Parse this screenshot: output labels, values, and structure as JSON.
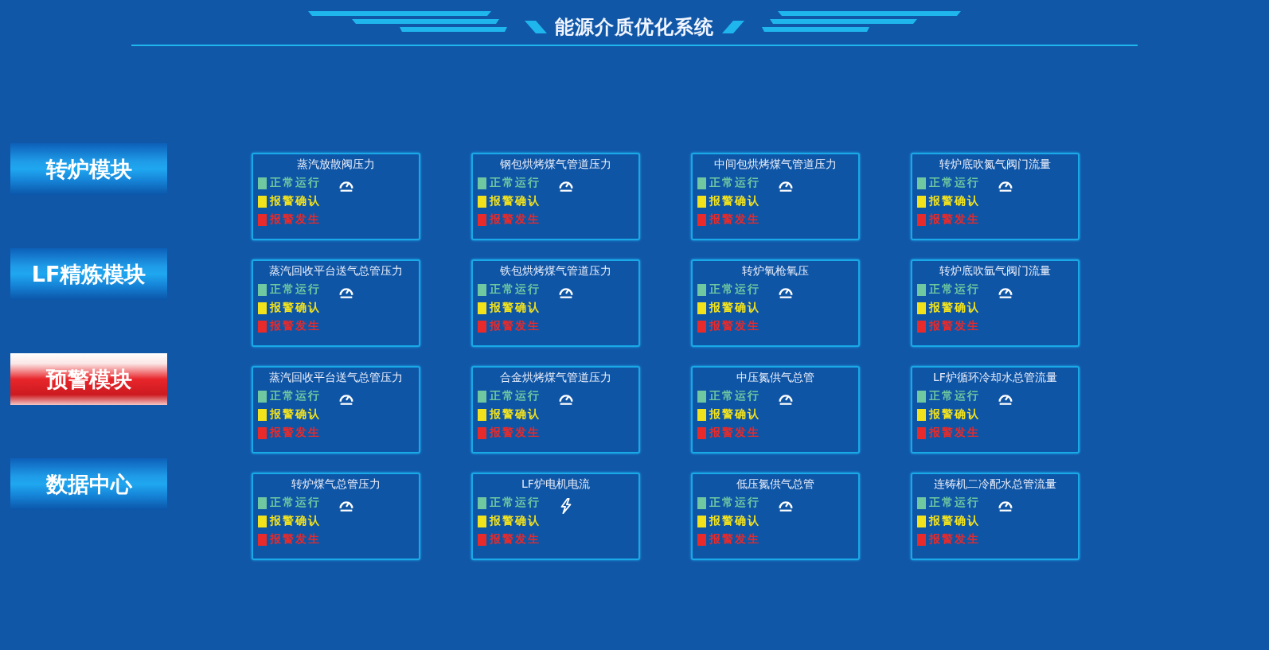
{
  "header": {
    "title": "能源介质优化系统"
  },
  "sidebar": {
    "items": [
      {
        "label": "转炉模块",
        "selected": false
      },
      {
        "label": "LF精炼模块",
        "selected": false
      },
      {
        "label": "预警模块",
        "selected": true
      },
      {
        "label": "数据中心",
        "selected": false
      }
    ]
  },
  "cards": [
    {
      "title": "蒸汽放散阀压力",
      "kind": "gauge",
      "legend": [
        {
          "label": "正常运行",
          "color": "#6fc8a0"
        },
        {
          "label": "报警确认",
          "color": "#f2e21c"
        },
        {
          "label": "报警发生",
          "color": "#e82a2a"
        }
      ]
    },
    {
      "title": "钢包烘烤煤气管道压力",
      "kind": "gauge",
      "legend": [
        {
          "label": "正常运行",
          "color": "#6fc8a0"
        },
        {
          "label": "报警确认",
          "color": "#f2e21c"
        },
        {
          "label": "报警发生",
          "color": "#e82a2a"
        }
      ]
    },
    {
      "title": "中间包烘烤煤气管道压力",
      "kind": "gauge",
      "legend": [
        {
          "label": "正常运行",
          "color": "#6fc8a0"
        },
        {
          "label": "报警确认",
          "color": "#f2e21c"
        },
        {
          "label": "报警发生",
          "color": "#e82a2a"
        }
      ]
    },
    {
      "title": "转炉底吹氮气阀门流量",
      "kind": "gauge",
      "legend": [
        {
          "label": "正常运行",
          "color": "#6fc8a0"
        },
        {
          "label": "报警确认",
          "color": "#f2e21c"
        },
        {
          "label": "报警发生",
          "color": "#e82a2a"
        }
      ]
    },
    {
      "title": "蒸汽回收平台送气总管压力",
      "kind": "gauge",
      "legend": [
        {
          "label": "正常运行",
          "color": "#6fc8a0"
        },
        {
          "label": "报警确认",
          "color": "#f2e21c"
        },
        {
          "label": "报警发生",
          "color": "#e82a2a"
        }
      ]
    },
    {
      "title": "铁包烘烤煤气管道压力",
      "kind": "gauge",
      "legend": [
        {
          "label": "正常运行",
          "color": "#6fc8a0"
        },
        {
          "label": "报警确认",
          "color": "#f2e21c"
        },
        {
          "label": "报警发生",
          "color": "#e82a2a"
        }
      ]
    },
    {
      "title": "转炉氧枪氧压",
      "kind": "gauge",
      "legend": [
        {
          "label": "正常运行",
          "color": "#6fc8a0"
        },
        {
          "label": "报警确认",
          "color": "#f2e21c"
        },
        {
          "label": "报警发生",
          "color": "#e82a2a"
        }
      ]
    },
    {
      "title": "转炉底吹氩气阀门流量",
      "kind": "gauge",
      "legend": [
        {
          "label": "正常运行",
          "color": "#6fc8a0"
        },
        {
          "label": "报警确认",
          "color": "#f2e21c"
        },
        {
          "label": "报警发生",
          "color": "#e82a2a"
        }
      ]
    },
    {
      "title": "蒸汽回收平台送气总管压力",
      "kind": "gauge",
      "legend": [
        {
          "label": "正常运行",
          "color": "#6fc8a0"
        },
        {
          "label": "报警确认",
          "color": "#f2e21c"
        },
        {
          "label": "报警发生",
          "color": "#e82a2a"
        }
      ]
    },
    {
      "title": "合金烘烤煤气管道压力",
      "kind": "gauge",
      "legend": [
        {
          "label": "正常运行",
          "color": "#6fc8a0"
        },
        {
          "label": "报警确认",
          "color": "#f2e21c"
        },
        {
          "label": "报警发生",
          "color": "#e82a2a"
        }
      ]
    },
    {
      "title": "中压氮供气总管",
      "kind": "gauge",
      "legend": [
        {
          "label": "正常运行",
          "color": "#6fc8a0"
        },
        {
          "label": "报警确认",
          "color": "#f2e21c"
        },
        {
          "label": "报警发生",
          "color": "#e82a2a"
        }
      ]
    },
    {
      "title": "LF炉循环冷却水总管流量",
      "kind": "gauge",
      "legend": [
        {
          "label": "正常运行",
          "color": "#6fc8a0"
        },
        {
          "label": "报警确认",
          "color": "#f2e21c"
        },
        {
          "label": "报警发生",
          "color": "#e82a2a"
        }
      ]
    },
    {
      "title": "转炉煤气总管压力",
      "kind": "gauge",
      "legend": [
        {
          "label": "正常运行",
          "color": "#6fc8a0"
        },
        {
          "label": "报警确认",
          "color": "#f2e21c"
        },
        {
          "label": "报警发生",
          "color": "#e82a2a"
        }
      ]
    },
    {
      "title": "LF炉电机电流",
      "kind": "bolt",
      "legend": [
        {
          "label": "正常运行",
          "color": "#6fc8a0"
        },
        {
          "label": "报警确认",
          "color": "#f2e21c"
        },
        {
          "label": "报警发生",
          "color": "#e82a2a"
        }
      ]
    },
    {
      "title": "低压氮供气总管",
      "kind": "gauge",
      "legend": [
        {
          "label": "正常运行",
          "color": "#6fc8a0"
        },
        {
          "label": "报警确认",
          "color": "#f2e21c"
        },
        {
          "label": "报警发生",
          "color": "#e82a2a"
        }
      ]
    },
    {
      "title": "连铸机二冷配水总管流量",
      "kind": "gauge",
      "legend": [
        {
          "label": "正常运行",
          "color": "#6fc8a0"
        },
        {
          "label": "报警确认",
          "color": "#f2e21c"
        },
        {
          "label": "报警发生",
          "color": "#e82a2a"
        }
      ]
    }
  ]
}
